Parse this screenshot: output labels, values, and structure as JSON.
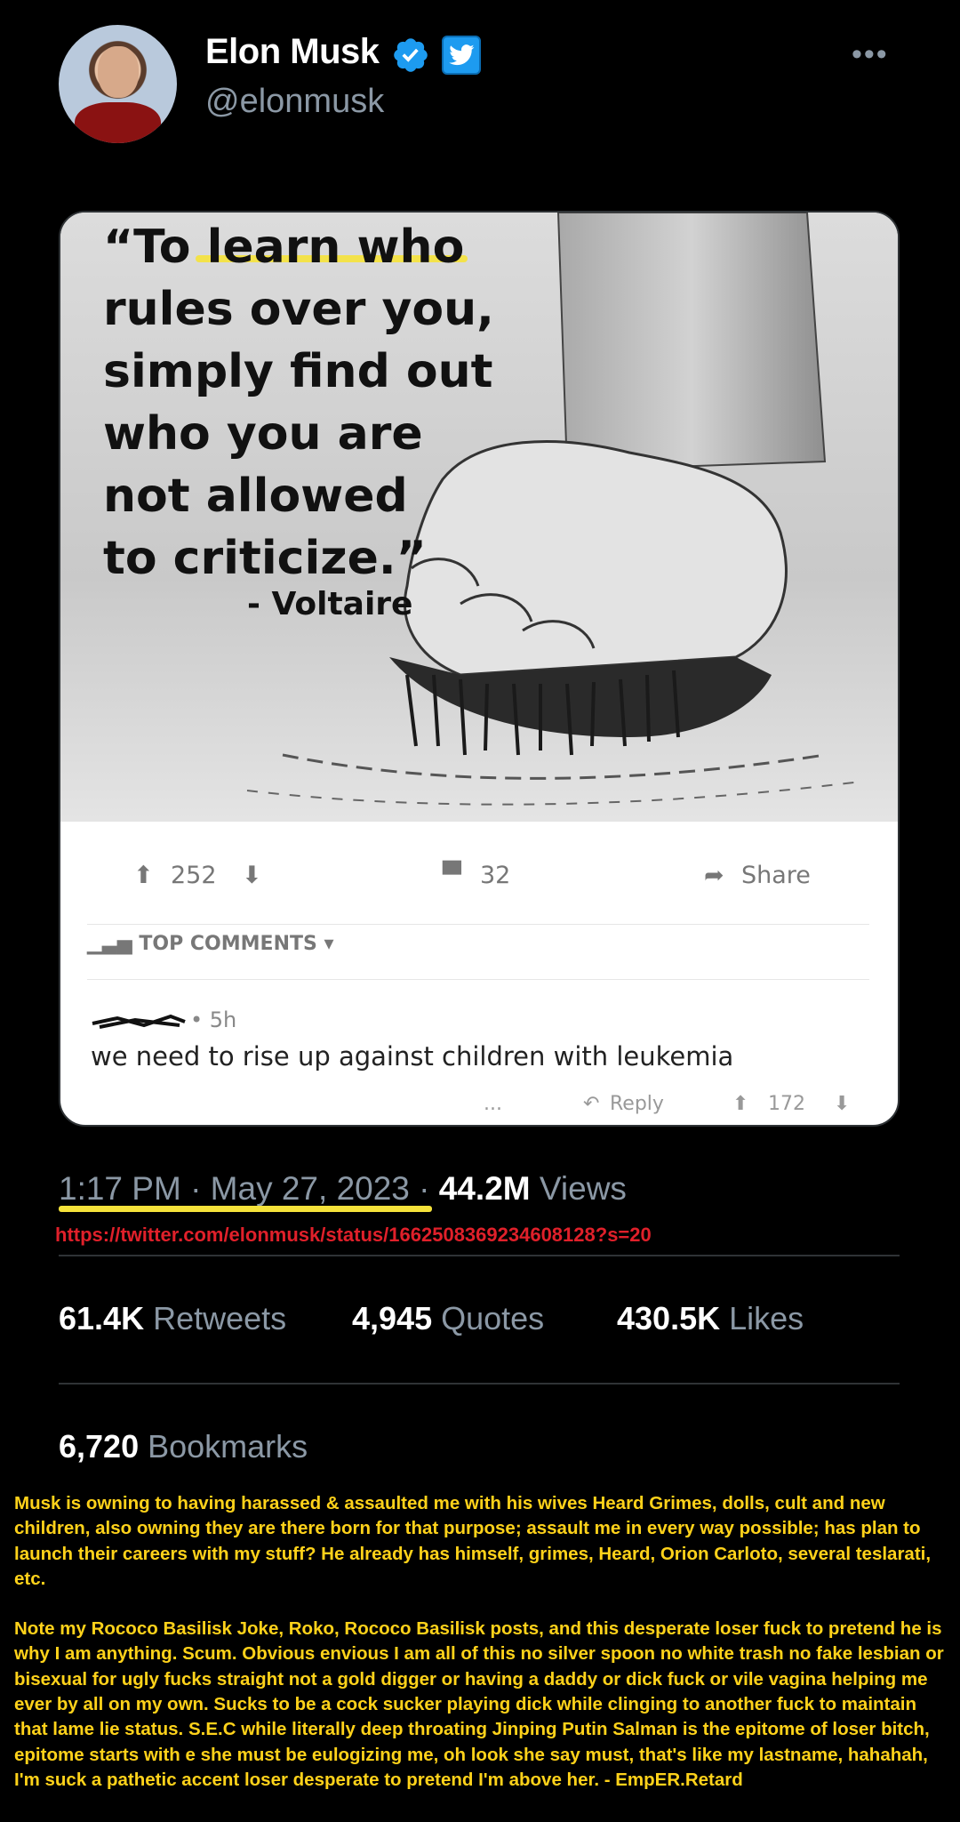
{
  "header": {
    "name": "Elon Musk",
    "handle": "@elonmusk",
    "more": "•••"
  },
  "meme": {
    "quote": "“To learn who\n rules over you,\n simply find out\n who you are\n not allowed\n to criticize.”",
    "author": "- Voltaire",
    "upvotes": "252",
    "comments": "32",
    "share": "Share",
    "top_comments": "TOP COMMENTS",
    "comment_meta": "• 5h",
    "comment_text": "we need to rise up against children with leukemia",
    "reply": "Reply",
    "comment_votes": "172",
    "ellipsis": "..."
  },
  "tweet_meta": {
    "time_date": "1:17 PM · May 27, 2023 · ",
    "views_count": "44.2M",
    "views_label": "Views",
    "url": "https://twitter.com/elonmusk/status/1662508369234608128?s=20"
  },
  "stats": {
    "retweets_count": "61.4K",
    "retweets_label": "Retweets",
    "quotes_count": "4,945",
    "quotes_label": "Quotes",
    "likes_count": "430.5K",
    "likes_label": "Likes",
    "bookmarks_count": "6,720",
    "bookmarks_label": "Bookmarks"
  },
  "commentary": {
    "p1": "Musk is owning to having harassed & assaulted me with his wives Heard Grimes, dolls, cult and new children, also owning they are there born for that purpose; assault me in every way possible; has plan to launch their careers with my stuff? He already has himself, grimes, Heard, Orion Carloto, several teslarati, etc.",
    "p2": "Note my Rococo Basilisk Joke, Roko, Rococo Basilisk posts, and this desperate loser fuck to pretend he is why I am anything. Scum. Obvious envious I am all of this no silver spoon no white trash no fake lesbian or bisexual for ugly fucks straight not a gold digger or having a daddy or dick fuck or vile vagina helping me ever by all on my own. Sucks to be a cock sucker playing dick while clinging to another fuck to maintain that lame lie status. S.E.C while literally deep throating Jinping Putin Salman is the epitome of loser bitch, epitome starts with e she must be eulogizing me, oh look she say must, that's like my lastname, hahahah, I'm suck a pathetic accent loser desperate to pretend I'm above her. - EmpER.Retard"
  },
  "colors": {
    "accent": "#1d9bf0",
    "highlight": "#f5e23a",
    "url": "#e0202a",
    "commentary": "#ffd21a"
  }
}
